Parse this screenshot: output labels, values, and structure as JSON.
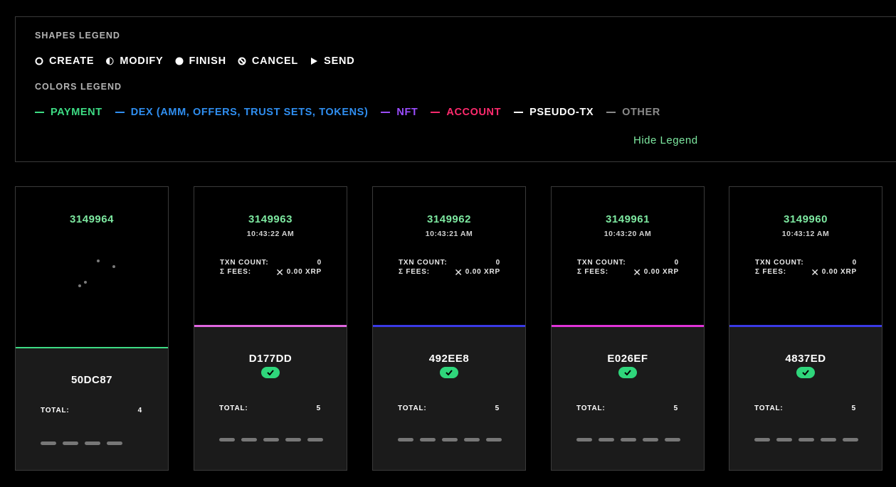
{
  "legend": {
    "shapes_title": "SHAPES LEGEND",
    "shapes": [
      {
        "icon": "create-icon",
        "label": "CREATE"
      },
      {
        "icon": "modify-icon",
        "label": "MODIFY"
      },
      {
        "icon": "finish-icon",
        "label": "FINISH"
      },
      {
        "icon": "cancel-icon",
        "label": "CANCEL"
      },
      {
        "icon": "send-icon",
        "label": "SEND"
      }
    ],
    "colors_title": "COLORS LEGEND",
    "colors": [
      {
        "label": "PAYMENT",
        "color": "#3ddc84"
      },
      {
        "label": "DEX (AMM, OFFERS, TRUST SETS, TOKENS)",
        "color": "#2f8ef0"
      },
      {
        "label": "NFT",
        "color": "#9b4dff"
      },
      {
        "label": "ACCOUNT",
        "color": "#ff2a6d"
      },
      {
        "label": "PSEUDO-TX",
        "color": "#ffffff"
      },
      {
        "label": "OTHER",
        "color": "#8a8a8a"
      }
    ],
    "hide_label": "Hide Legend",
    "hide_color": "#7de8a0"
  },
  "accent_green": "#7de8a0",
  "check_color": "#2fd67b",
  "cards": [
    {
      "ledger": "3149964",
      "time": "",
      "txn_label": "",
      "txn_value": "",
      "fees_label": "",
      "fees_value": "",
      "hash": "50DC87",
      "verified": false,
      "total_label": "TOTAL:",
      "total": "4",
      "pills": 4,
      "bar_color": "#3ddc84",
      "loading": true
    },
    {
      "ledger": "3149963",
      "time": "10:43:22 AM",
      "txn_label": "TXN COUNT:",
      "txn_value": "0",
      "fees_label": "Σ FEES:",
      "fees_value": "0.00 XRP",
      "hash": "D177DD",
      "verified": true,
      "total_label": "TOTAL:",
      "total": "5",
      "pills": 5,
      "bar_color": "#e066e0",
      "loading": false
    },
    {
      "ledger": "3149962",
      "time": "10:43:21 AM",
      "txn_label": "TXN COUNT:",
      "txn_value": "0",
      "fees_label": "Σ FEES:",
      "fees_value": "0.00 XRP",
      "hash": "492EE8",
      "verified": true,
      "total_label": "TOTAL:",
      "total": "5",
      "pills": 5,
      "bar_color": "#3a3ae6",
      "loading": false
    },
    {
      "ledger": "3149961",
      "time": "10:43:20 AM",
      "txn_label": "TXN COUNT:",
      "txn_value": "0",
      "fees_label": "Σ FEES:",
      "fees_value": "0.00 XRP",
      "hash": "E026EF",
      "verified": true,
      "total_label": "TOTAL:",
      "total": "5",
      "pills": 5,
      "bar_color": "#e033d8",
      "loading": false
    },
    {
      "ledger": "3149960",
      "time": "10:43:12 AM",
      "txn_label": "TXN COUNT:",
      "txn_value": "0",
      "fees_label": "Σ FEES:",
      "fees_value": "0.00 XRP",
      "hash": "4837ED",
      "verified": true,
      "total_label": "TOTAL:",
      "total": "5",
      "pills": 5,
      "bar_color": "#3a3ae6",
      "loading": false
    }
  ]
}
